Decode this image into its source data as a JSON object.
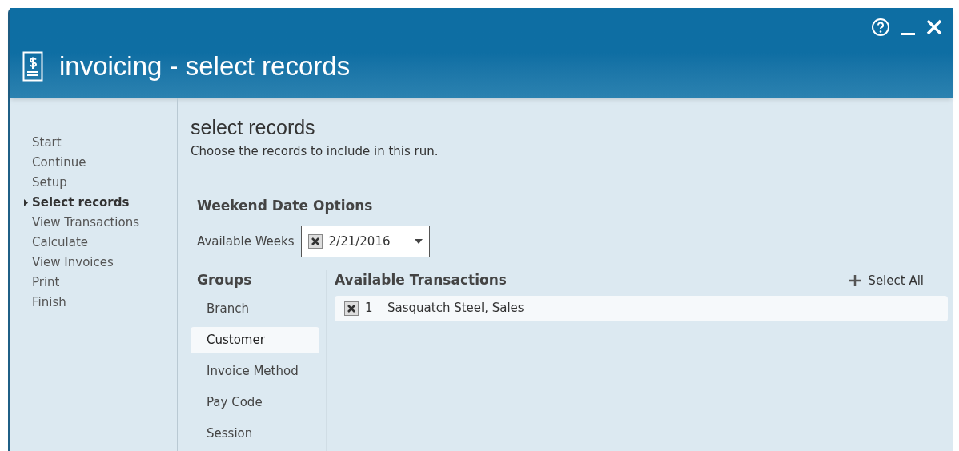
{
  "window": {
    "title": "invoicing - select records"
  },
  "steps": [
    {
      "label": "Start",
      "selected": false
    },
    {
      "label": "Continue",
      "selected": false
    },
    {
      "label": "Setup",
      "selected": false
    },
    {
      "label": "Select records",
      "selected": true
    },
    {
      "label": "View Transactions",
      "selected": false
    },
    {
      "label": "Calculate",
      "selected": false
    },
    {
      "label": "View Invoices",
      "selected": false
    },
    {
      "label": "Print",
      "selected": false
    },
    {
      "label": "Finish",
      "selected": false
    }
  ],
  "page": {
    "heading": "select records",
    "description": "Choose the records to include in this run."
  },
  "weekend_date_options": {
    "heading": "Weekend Date Options",
    "label": "Available Weeks",
    "checked": true,
    "value": "2/21/2016"
  },
  "groups": {
    "heading": "Groups",
    "items": [
      {
        "label": "Branch",
        "selected": false
      },
      {
        "label": "Customer",
        "selected": true
      },
      {
        "label": "Invoice Method",
        "selected": false
      },
      {
        "label": "Pay Code",
        "selected": false
      },
      {
        "label": "Session",
        "selected": false
      }
    ]
  },
  "transactions": {
    "heading": "Available Transactions",
    "select_all": "Select All",
    "rows": [
      {
        "checked": true,
        "count": "1",
        "name": "Sasquatch Steel, Sales"
      }
    ]
  }
}
